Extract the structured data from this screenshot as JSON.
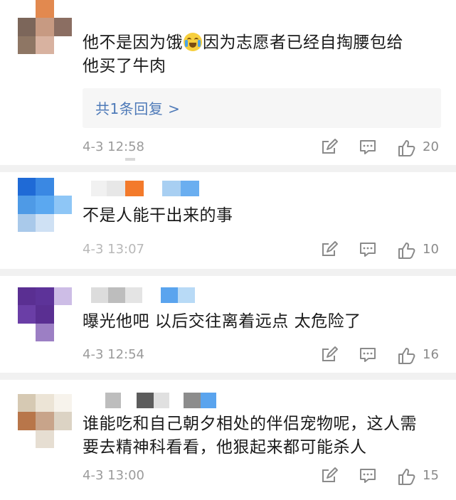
{
  "comments": [
    {
      "text_line1_a": "他不是因为饿",
      "text_line1_b": "因为志愿者已经自掏腰包给",
      "text_line2": "他买了牛肉",
      "reply_label": "共1条回复 >",
      "time": "4-3 12:58",
      "likes": "20",
      "emoji": "crying-laughing-emoji"
    },
    {
      "text": "不是人能干出来的事",
      "time": "4-3 13:07",
      "likes": "10"
    },
    {
      "text": "曝光他吧 以后交往离着远点 太危险了",
      "time": "4-3 12:54",
      "likes": "16"
    },
    {
      "text_line1": "谁能吃和自己朝夕相处的伴侣宠物呢，这人需",
      "text_line2": "要去精神科看看，他狠起来都可能杀人",
      "time": "4-3 13:00",
      "likes": "15"
    }
  ],
  "icons": {
    "share": "share-edit-icon",
    "comment": "comment-icon",
    "like": "thumbs-up-icon"
  },
  "colors": {
    "reply_link": "#4e7ab8",
    "meta_gray": "#9b9b9b",
    "divider": "#f1f1f1"
  }
}
